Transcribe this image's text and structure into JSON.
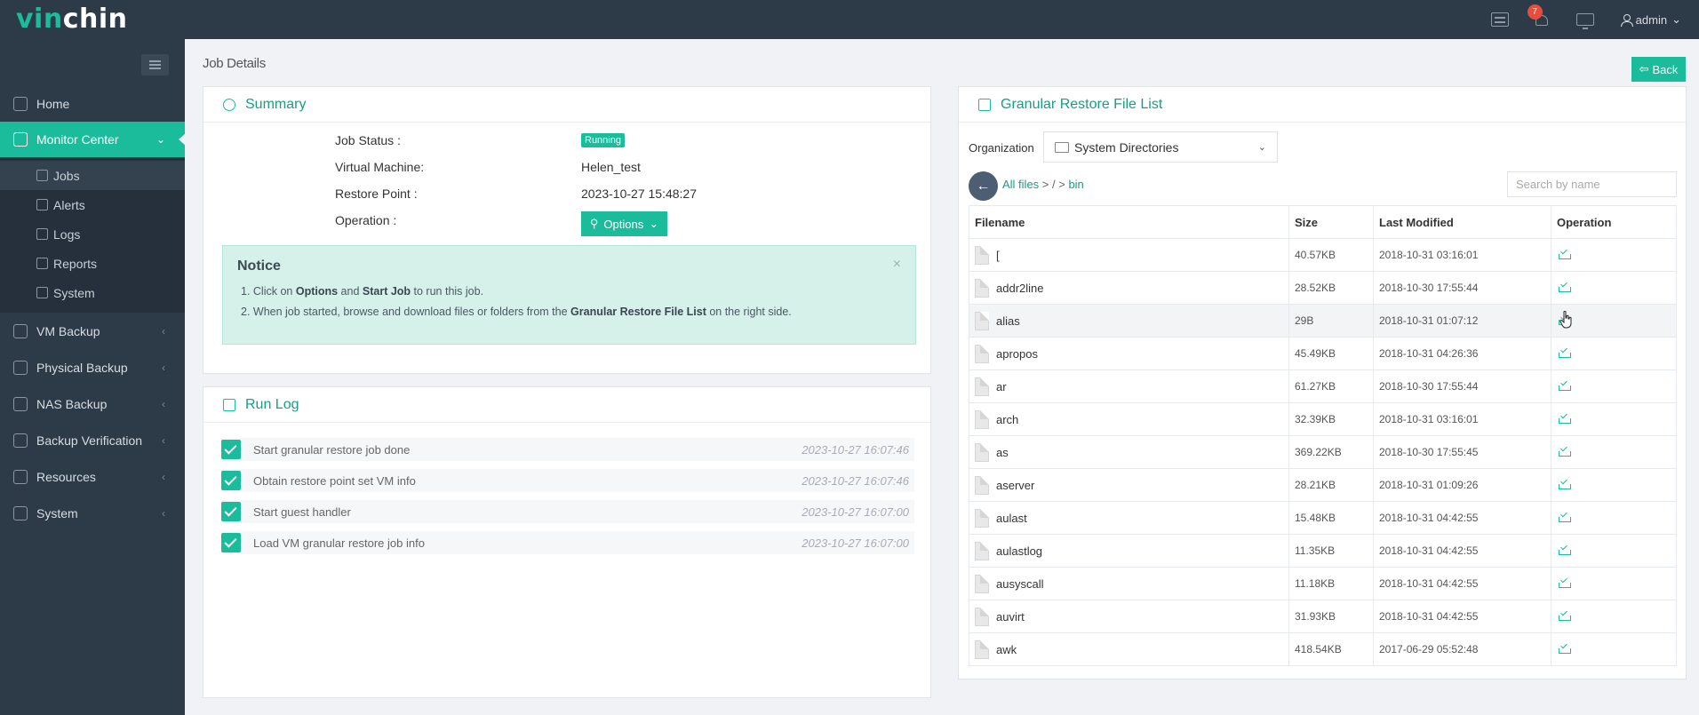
{
  "topbar": {
    "logo_prefix": "vin",
    "logo_suffix": "chin",
    "notification_count": "7",
    "user": "admin",
    "user_caret": "⌄"
  },
  "sidebar": {
    "items": [
      {
        "label": "Home",
        "icon": "home-icon"
      },
      {
        "label": "Monitor Center",
        "icon": "monitor-icon",
        "caret": "⌄"
      },
      {
        "label": "VM Backup",
        "icon": "vm-icon",
        "caret": "‹"
      },
      {
        "label": "Physical Backup",
        "icon": "server-icon",
        "caret": "‹"
      },
      {
        "label": "NAS Backup",
        "icon": "nas-icon",
        "caret": "‹"
      },
      {
        "label": "Backup Verification",
        "icon": "verify-icon",
        "caret": "‹"
      },
      {
        "label": "Resources",
        "icon": "resources-icon",
        "caret": "‹"
      },
      {
        "label": "System",
        "icon": "system-icon",
        "caret": "‹"
      }
    ],
    "subitems": [
      {
        "label": "Jobs"
      },
      {
        "label": "Alerts"
      },
      {
        "label": "Logs"
      },
      {
        "label": "Reports"
      },
      {
        "label": "System"
      }
    ]
  },
  "page": {
    "title": "Job Details",
    "back_label": "Back",
    "back_arrow": "⇦"
  },
  "summary": {
    "title": "Summary",
    "job_status_label": "Job Status :",
    "job_status_value": "Running",
    "vm_label": "Virtual Machine:",
    "vm_value": "Helen_test",
    "restore_point_label": "Restore Point :",
    "restore_point_value": "2023-10-27 15:48:27",
    "operation_label": "Operation :",
    "options_label": "Options",
    "options_caret": "⌄",
    "options_icon_glyph": "⚲",
    "notice": {
      "title": "Notice",
      "close": "×",
      "line1_prefix": "1. Click on ",
      "line1_bold1": "Options",
      "line1_mid": " and ",
      "line1_bold2": "Start Job",
      "line1_suffix": " to run this job.",
      "line2_prefix": "2. When job started, browse and download files or folders from the ",
      "line2_bold": "Granular Restore File List",
      "line2_suffix": " on the right side."
    }
  },
  "runlog": {
    "title": "Run Log",
    "entries": [
      {
        "text": "Start granular restore job done",
        "time": "2023-10-27 16:07:46"
      },
      {
        "text": "Obtain restore point set VM info",
        "time": "2023-10-27 16:07:46"
      },
      {
        "text": "Start guest handler",
        "time": "2023-10-27 16:07:00"
      },
      {
        "text": "Load VM granular restore job info",
        "time": "2023-10-27 16:07:00"
      }
    ]
  },
  "filelist": {
    "title": "Granular Restore File List",
    "org_label": "Organization",
    "org_value": "System Directories",
    "org_caret": "⌄",
    "back_arrow": "←",
    "crumb_all": "All files",
    "crumb_sep1": " > / > ",
    "crumb_current": "bin",
    "search_placeholder": "Search by name",
    "columns": [
      "Filename",
      "Size",
      "Last Modified",
      "Operation"
    ],
    "rows": [
      {
        "name": "[",
        "size": "40.57KB",
        "modified": "2018-10-31 03:16:01"
      },
      {
        "name": "addr2line",
        "size": "28.52KB",
        "modified": "2018-10-30 17:55:44"
      },
      {
        "name": "alias",
        "size": "29B",
        "modified": "2018-10-31 01:07:12"
      },
      {
        "name": "apropos",
        "size": "45.49KB",
        "modified": "2018-10-31 04:26:36"
      },
      {
        "name": "ar",
        "size": "61.27KB",
        "modified": "2018-10-30 17:55:44"
      },
      {
        "name": "arch",
        "size": "32.39KB",
        "modified": "2018-10-31 03:16:01"
      },
      {
        "name": "as",
        "size": "369.22KB",
        "modified": "2018-10-30 17:55:45"
      },
      {
        "name": "aserver",
        "size": "28.21KB",
        "modified": "2018-10-31 01:09:26"
      },
      {
        "name": "aulast",
        "size": "15.48KB",
        "modified": "2018-10-31 04:42:55"
      },
      {
        "name": "aulastlog",
        "size": "11.35KB",
        "modified": "2018-10-31 04:42:55"
      },
      {
        "name": "ausyscall",
        "size": "11.18KB",
        "modified": "2018-10-31 04:42:55"
      },
      {
        "name": "auvirt",
        "size": "31.93KB",
        "modified": "2018-10-31 04:42:55"
      },
      {
        "name": "awk",
        "size": "418.54KB",
        "modified": "2017-06-29 05:52:48"
      }
    ]
  },
  "colors": {
    "accent": "#1bbc9b",
    "sidebar_bg": "#2d3a48",
    "badge_red": "#e74c3c"
  }
}
